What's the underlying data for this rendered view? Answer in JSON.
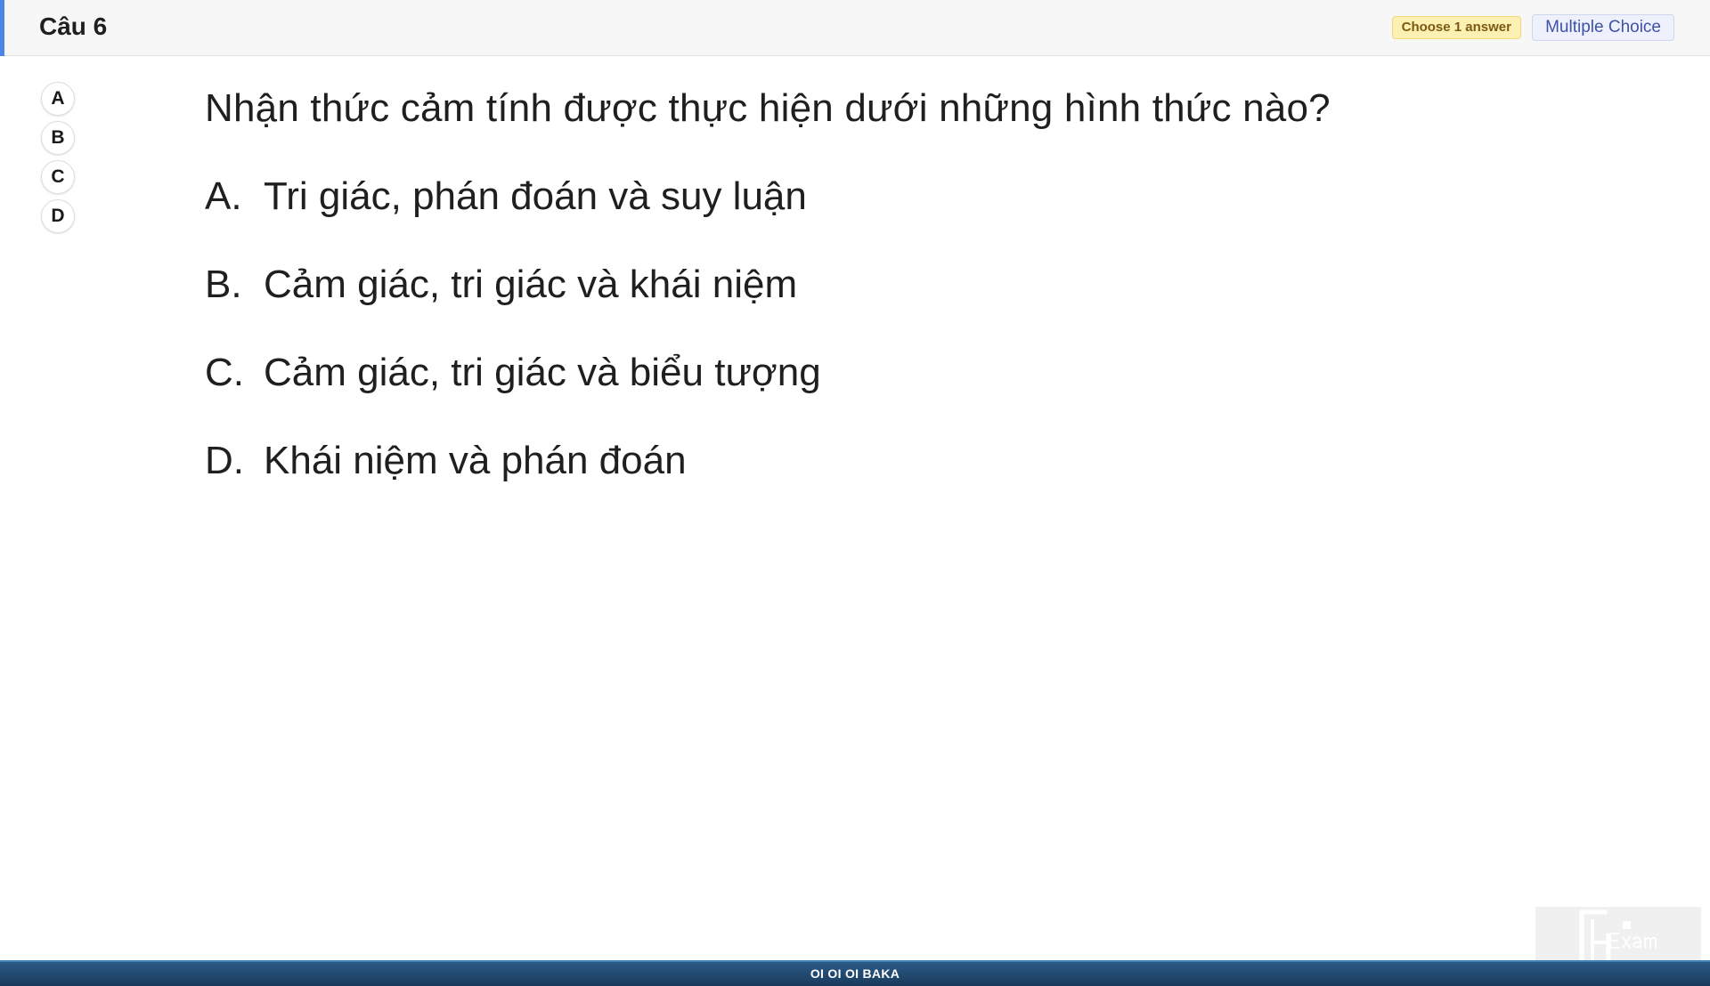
{
  "header": {
    "question_number": "Câu 6",
    "choose_badge": "Choose 1 answer",
    "question_type": "Multiple Choice"
  },
  "answer_selector": {
    "options": [
      "A",
      "B",
      "C",
      "D"
    ]
  },
  "question": {
    "text": "Nhận thức cảm tính được thực hiện dưới những hình thức nào?",
    "choices": [
      {
        "letter": "A.",
        "text": "Tri giác, phán đoán và suy luận"
      },
      {
        "letter": "B.",
        "text": "Cảm giác, tri giác và khái niệm"
      },
      {
        "letter": "C.",
        "text": "Cảm giác, tri giác và biểu tượng"
      },
      {
        "letter": "D.",
        "text": "Khái niệm và phán đoán"
      }
    ]
  },
  "footer": {
    "text": "OI OI OI BAKA"
  },
  "logo": {
    "text": "FU Exam"
  },
  "colors": {
    "accent": "#4a86e8",
    "footer_bg": "#1f4a70",
    "badge_yellow": "#fdf0b3",
    "badge_blue_text": "#3f52a8"
  }
}
